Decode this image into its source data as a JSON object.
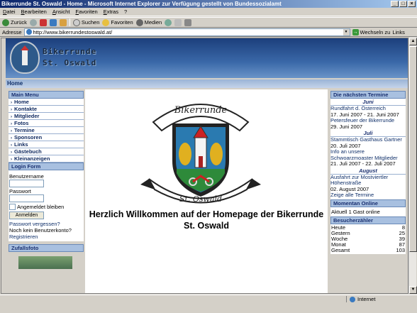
{
  "window": {
    "title": "Bikerrunde St. Oswald - Home - Microsoft Internet Explorer  zur Verfügung gestellt von Bundessozialamt"
  },
  "menubar": [
    "Datei",
    "Bearbeiten",
    "Ansicht",
    "Favoriten",
    "Extras",
    "?"
  ],
  "toolbar": {
    "back": "Zurück",
    "search": "Suchen",
    "favorites": "Favoriten",
    "media": "Medien"
  },
  "address": {
    "label": "Adresse",
    "url": "http://www.bikerrundestoswald.at/",
    "go": "Wechseln zu",
    "links": "Links"
  },
  "site": {
    "title_line1": "Bikerrunde",
    "title_line2": "St. Oswald",
    "breadcrumb": "Home",
    "emblem_text_top": "Bikerrunde",
    "emblem_text_bottom": "St. Oswald",
    "welcome": "Herzlich Willkommen auf der Homepage der Bikerrunde St. Oswald"
  },
  "main_menu": {
    "heading": "Main Menu",
    "items": [
      "Home",
      "Kontakte",
      "Mitglieder",
      "Fotos",
      "Termine",
      "Sponsoren",
      "Links",
      "Gästebuch",
      "Kleinanzeigen"
    ]
  },
  "login": {
    "heading": "Login Form",
    "username_label": "Benutzername",
    "password_label": "Passwort",
    "remember_label": "Angemeldet bleiben",
    "submit": "Anmelden",
    "forgot": "Passwort vergessen?",
    "no_account": "Noch kein Benutzerkonto?",
    "register": "Registrieren"
  },
  "zufallsfoto": {
    "heading": "Zufallsfoto"
  },
  "termine": {
    "heading": "Die nächsten Termine",
    "months": [
      {
        "name": "Juni",
        "events": [
          {
            "title": "Rundfahrt d. Österreich",
            "date": "17. Juni 2007 - 21. Juni 2007"
          },
          {
            "title": "Petersfeuer der Bikerrunde",
            "date": "29. Juni 2007"
          }
        ]
      },
      {
        "name": "Juli",
        "events": [
          {
            "title": "Stammtisch Gasthaus Gartner",
            "date": "20. Juli 2007"
          },
          {
            "title": "Info an unsere Schwoarzmoaster Mitglieder",
            "date": "21. Juli 2007 - 22. Juli 2007"
          }
        ]
      },
      {
        "name": "August",
        "events": [
          {
            "title": "Ausfahrt zur Mostviertler Höhenstraße",
            "date": "02. August 2007"
          }
        ]
      }
    ],
    "show_all": "Zeige alle Termine"
  },
  "online": {
    "heading": "Momentan Online",
    "text": "Aktuell 1 Gast online"
  },
  "besucher": {
    "heading": "Besucherzähler",
    "rows": [
      {
        "label": "Heute",
        "value": "8"
      },
      {
        "label": "Gestern",
        "value": "25"
      },
      {
        "label": "Woche",
        "value": "39"
      },
      {
        "label": "Monat",
        "value": "87"
      },
      {
        "label": "Gesamt",
        "value": "103"
      }
    ]
  },
  "status": {
    "zone": "Internet"
  },
  "colors": {
    "header_dark": "#1c3f7c",
    "box_head": "#a8c0e0",
    "link": "#10306a"
  }
}
